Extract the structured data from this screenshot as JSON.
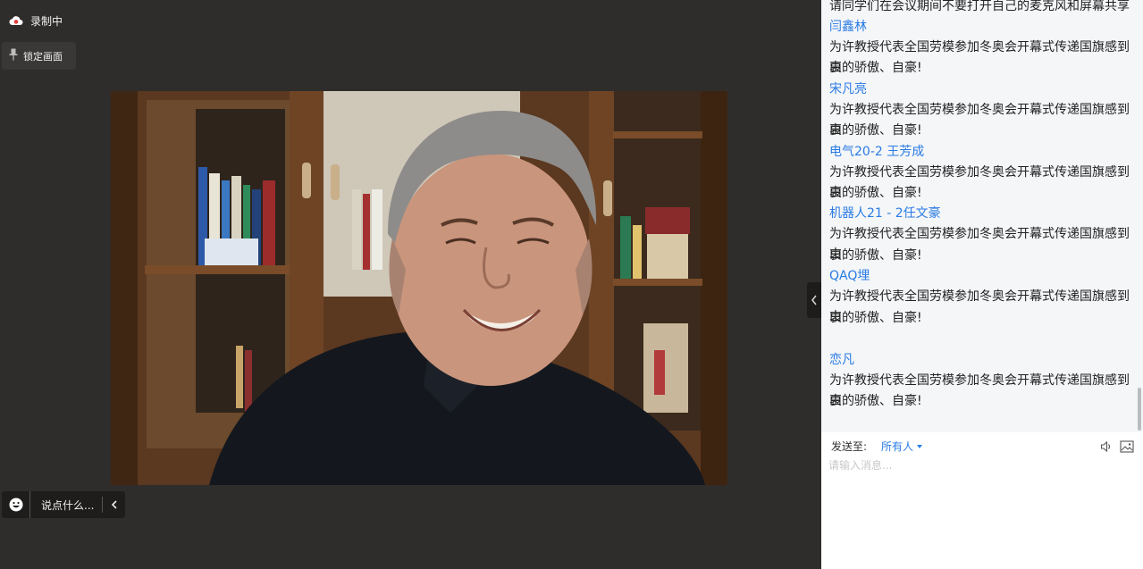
{
  "recording": {
    "label": "录制中"
  },
  "lock_view": {
    "label": "锁定画面"
  },
  "say_bar": {
    "placeholder": "说点什么..."
  },
  "chat": {
    "messages": [
      {
        "text": "请同学们在会议期间不要打开自己的麦克风和屏幕共享"
      },
      {
        "author": "闫鑫林",
        "text": [
          "为许教授代表全国劳模参加冬奥会开幕式传递国旗感到由",
          "衷的骄傲、自豪!"
        ]
      },
      {
        "author": "宋凡亮",
        "text": [
          "为许教授代表全国劳模参加冬奥会开幕式传递国旗感到由",
          "衷的骄傲、自豪!"
        ]
      },
      {
        "author": "电气20-2  王芳成",
        "text": [
          "为许教授代表全国劳模参加冬奥会开幕式传递国旗感到由",
          "衷的骄傲、自豪!"
        ]
      },
      {
        "author": "机器人21 - 2任文豪",
        "text": [
          "为许教授代表全国劳模参加冬奥会开幕式传递国旗感到由",
          "衷的骄傲、自豪!"
        ]
      },
      {
        "author": "QAQ埋",
        "text": [
          "为许教授代表全国劳模参加冬奥会开幕式传递国旗感到由",
          "衷的骄傲、自豪!"
        ]
      },
      {
        "author": "恋凡",
        "text": [
          "为许教授代表全国劳模参加冬奥会开幕式传递国旗感到由",
          "衷的骄傲、自豪!"
        ]
      }
    ],
    "send_to_label": "发送至:",
    "send_to_value": "所有人",
    "input_placeholder": "请输入消息..."
  },
  "colors": {
    "link": "#2a7be4",
    "stage_bg": "#2f2d2b",
    "chat_bg": "#f4f6f8"
  },
  "icons": [
    "cloud-record-icon",
    "pin-icon",
    "smiley-icon",
    "chevron-left-icon",
    "speaker-icon",
    "image-icon"
  ]
}
